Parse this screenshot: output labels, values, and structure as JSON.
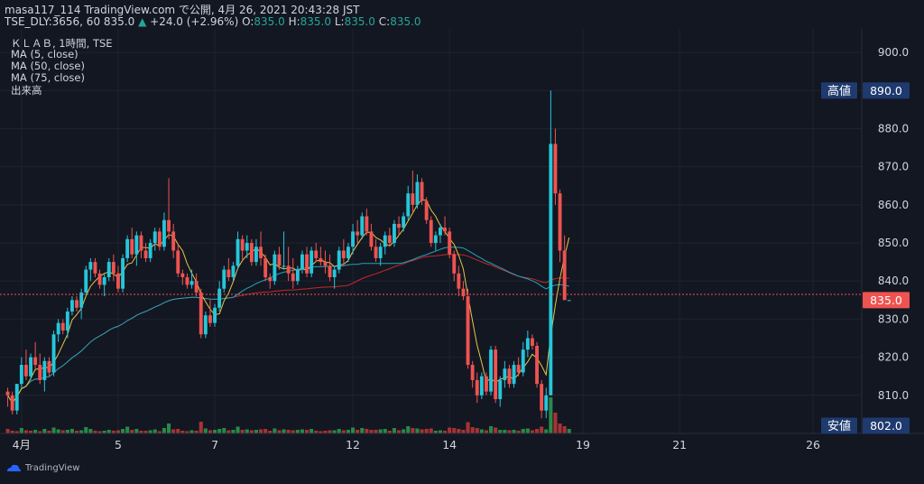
{
  "header": {
    "line1": "masa117_114 TradingView.com で公開, 4月 26, 2021 20:43:28 JST",
    "symbol_prefix": "TSE_DLY:3656, 60 835.0",
    "change_arrow": "▲",
    "change": "+24.0 (+2.96%)",
    "o_label": "O:",
    "o_value": "835.0",
    "h_label": "H:",
    "h_value": "835.0",
    "l_label": "L:",
    "l_value": "835.0",
    "c_label": "C:",
    "c_value": "835.0"
  },
  "legend": {
    "title": "ＫＬＡＢ, 1時間, TSE",
    "ma5": "MA (5, close)",
    "ma50": "MA (50, close)",
    "ma75": "MA (75, close)",
    "volume": "出来高"
  },
  "badges": {
    "high_label": "高値",
    "high_value": "890.0",
    "low_label": "安値",
    "low_value": "802.0",
    "last_value": "835.0"
  },
  "branding": {
    "logo_text": "TradingView"
  },
  "colors": {
    "background": "#131722",
    "up": "#26c6da",
    "down": "#ef5350",
    "ma5": "#e8c547",
    "ma50": "#21a4b8",
    "ma75": "#c62828",
    "vol_down": "#c2383a",
    "vol_up": "#2e9e4f",
    "badge_bg": "#1e3a6e",
    "last_bg": "#ef5350"
  },
  "chart_data": {
    "type": "candlestick",
    "ylim": [
      800,
      905
    ],
    "y_ticks": [
      "810.0",
      "820.0",
      "830.0",
      "840.0",
      "850.0",
      "860.0",
      "870.0",
      "880.0",
      "890.0",
      "900.0"
    ],
    "y_tick_values": [
      810,
      820,
      830,
      840,
      850,
      860,
      870,
      880,
      890,
      900
    ],
    "x_ticks": [
      {
        "label": "4月",
        "bar": 3
      },
      {
        "label": "5",
        "bar": 24
      },
      {
        "label": "7",
        "bar": 45
      },
      {
        "label": "12",
        "bar": 75
      },
      {
        "label": "14",
        "bar": 96
      },
      {
        "label": "19",
        "bar": 125
      },
      {
        "label": "21",
        "bar": 146
      },
      {
        "label": "26",
        "bar": 175
      }
    ],
    "candles": [
      [
        811,
        812,
        807,
        810
      ],
      [
        810,
        811,
        805,
        806
      ],
      [
        806,
        813,
        805,
        813
      ],
      [
        813,
        820,
        812,
        818
      ],
      [
        818,
        822,
        814,
        815
      ],
      [
        815,
        821,
        814,
        820
      ],
      [
        820,
        824,
        817,
        818
      ],
      [
        818,
        821,
        813,
        814
      ],
      [
        814,
        820,
        811,
        819
      ],
      [
        819,
        820,
        815,
        816
      ],
      [
        816,
        827,
        815,
        826
      ],
      [
        826,
        830,
        824,
        829
      ],
      [
        829,
        830,
        826,
        827
      ],
      [
        827,
        833,
        825,
        832
      ],
      [
        832,
        836,
        831,
        835
      ],
      [
        835,
        836,
        832,
        833
      ],
      [
        833,
        838,
        830,
        837
      ],
      [
        837,
        844,
        836,
        843
      ],
      [
        843,
        846,
        840,
        845
      ],
      [
        845,
        846,
        841,
        842
      ],
      [
        842,
        843,
        838,
        839
      ],
      [
        839,
        842,
        836,
        841
      ],
      [
        841,
        846,
        840,
        845
      ],
      [
        845,
        847,
        840,
        842
      ],
      [
        842,
        844,
        837,
        838
      ],
      [
        838,
        847,
        837,
        846
      ],
      [
        846,
        852,
        845,
        851
      ],
      [
        851,
        854,
        846,
        847
      ],
      [
        847,
        853,
        844,
        852
      ],
      [
        852,
        853,
        846,
        848
      ],
      [
        848,
        850,
        845,
        846
      ],
      [
        846,
        851,
        845,
        850
      ],
      [
        850,
        854,
        848,
        853
      ],
      [
        853,
        854,
        848,
        849
      ],
      [
        849,
        858,
        848,
        856
      ],
      [
        856,
        867,
        851,
        853
      ],
      [
        853,
        855,
        846,
        848
      ],
      [
        848,
        850,
        841,
        842
      ],
      [
        842,
        843,
        839,
        841
      ],
      [
        841,
        842,
        838,
        839
      ],
      [
        839,
        843,
        838,
        840
      ],
      [
        840,
        842,
        836,
        837
      ],
      [
        837,
        838,
        825,
        826
      ],
      [
        826,
        832,
        825,
        831
      ],
      [
        831,
        835,
        828,
        829
      ],
      [
        829,
        834,
        828,
        833
      ],
      [
        833,
        840,
        832,
        838
      ],
      [
        838,
        844,
        837,
        843
      ],
      [
        843,
        846,
        840,
        841
      ],
      [
        841,
        845,
        840,
        844
      ],
      [
        844,
        853,
        843,
        851
      ],
      [
        851,
        852,
        845,
        848
      ],
      [
        848,
        852,
        846,
        850
      ],
      [
        850,
        851,
        844,
        845
      ],
      [
        845,
        851,
        844,
        849
      ],
      [
        849,
        853,
        844,
        846
      ],
      [
        846,
        847,
        840,
        841
      ],
      [
        841,
        842,
        838,
        840
      ],
      [
        840,
        848,
        839,
        847
      ],
      [
        847,
        849,
        843,
        844
      ],
      [
        844,
        853,
        843,
        844
      ],
      [
        844,
        849,
        840,
        842
      ],
      [
        842,
        846,
        838,
        840
      ],
      [
        840,
        844,
        839,
        843
      ],
      [
        843,
        848,
        842,
        847
      ],
      [
        847,
        849,
        841,
        842
      ],
      [
        842,
        849,
        841,
        848
      ],
      [
        848,
        850,
        845,
        846
      ],
      [
        846,
        849,
        844,
        845
      ],
      [
        845,
        848,
        842,
        844
      ],
      [
        844,
        847,
        840,
        841
      ],
      [
        841,
        844,
        838,
        843
      ],
      [
        843,
        849,
        842,
        848
      ],
      [
        848,
        851,
        844,
        846
      ],
      [
        846,
        850,
        845,
        849
      ],
      [
        849,
        855,
        847,
        853
      ],
      [
        853,
        856,
        850,
        852
      ],
      [
        852,
        858,
        851,
        857
      ],
      [
        857,
        859,
        852,
        853
      ],
      [
        853,
        855,
        848,
        849
      ],
      [
        849,
        851,
        845,
        846
      ],
      [
        846,
        850,
        844,
        849
      ],
      [
        849,
        853,
        847,
        852
      ],
      [
        852,
        854,
        849,
        850
      ],
      [
        850,
        856,
        849,
        855
      ],
      [
        855,
        857,
        852,
        854
      ],
      [
        854,
        858,
        853,
        857
      ],
      [
        857,
        865,
        856,
        863
      ],
      [
        863,
        869,
        858,
        860
      ],
      [
        860,
        868,
        859,
        866
      ],
      [
        866,
        867,
        860,
        861
      ],
      [
        861,
        862,
        855,
        856
      ],
      [
        856,
        857,
        849,
        850
      ],
      [
        850,
        853,
        848,
        852
      ],
      [
        852,
        855,
        850,
        854
      ],
      [
        854,
        857,
        852,
        853
      ],
      [
        853,
        854,
        846,
        847
      ],
      [
        847,
        848,
        840,
        842
      ],
      [
        842,
        844,
        836,
        838
      ],
      [
        838,
        840,
        835,
        836
      ],
      [
        836,
        838,
        817,
        818
      ],
      [
        818,
        819,
        812,
        814
      ],
      [
        814,
        816,
        808,
        810
      ],
      [
        810,
        816,
        809,
        815
      ],
      [
        815,
        816,
        810,
        811
      ],
      [
        811,
        823,
        810,
        822
      ],
      [
        822,
        823,
        808,
        809
      ],
      [
        809,
        815,
        807,
        814
      ],
      [
        814,
        819,
        812,
        817
      ],
      [
        817,
        818,
        812,
        813
      ],
      [
        813,
        819,
        812,
        818
      ],
      [
        818,
        820,
        815,
        816
      ],
      [
        816,
        824,
        815,
        822
      ],
      [
        822,
        827,
        820,
        825
      ],
      [
        825,
        826,
        822,
        823
      ],
      [
        823,
        824,
        812,
        813
      ],
      [
        813,
        814,
        804,
        806
      ],
      [
        806,
        812,
        804,
        810
      ],
      [
        810,
        890,
        810,
        876
      ],
      [
        876,
        880,
        860,
        863
      ],
      [
        863,
        864,
        845,
        848
      ],
      [
        848,
        852,
        836,
        835
      ],
      [
        835,
        835,
        835,
        835
      ]
    ],
    "volume": [
      [
        1,
        0
      ],
      [
        0.6,
        0
      ],
      [
        0.5,
        0
      ],
      [
        1.2,
        1
      ],
      [
        0.7,
        0
      ],
      [
        0.6,
        0
      ],
      [
        0.8,
        1
      ],
      [
        0.5,
        0
      ],
      [
        1,
        1
      ],
      [
        0.6,
        0
      ],
      [
        1.3,
        1
      ],
      [
        0.9,
        1
      ],
      [
        0.7,
        0
      ],
      [
        0.8,
        1
      ],
      [
        1,
        1
      ],
      [
        0.6,
        0
      ],
      [
        0.7,
        1
      ],
      [
        1.4,
        1
      ],
      [
        1,
        1
      ],
      [
        0.6,
        0
      ],
      [
        0.5,
        0
      ],
      [
        0.6,
        1
      ],
      [
        0.8,
        1
      ],
      [
        0.6,
        0
      ],
      [
        0.7,
        0
      ],
      [
        1,
        1
      ],
      [
        1.5,
        1
      ],
      [
        0.8,
        0
      ],
      [
        1,
        1
      ],
      [
        0.6,
        0
      ],
      [
        0.6,
        0
      ],
      [
        0.7,
        1
      ],
      [
        0.9,
        1
      ],
      [
        0.5,
        0
      ],
      [
        1.2,
        1
      ],
      [
        2.2,
        1
      ],
      [
        0.9,
        0
      ],
      [
        1,
        0
      ],
      [
        0.6,
        0
      ],
      [
        0.5,
        0
      ],
      [
        0.7,
        1
      ],
      [
        0.6,
        0
      ],
      [
        2.6,
        0
      ],
      [
        1.1,
        1
      ],
      [
        0.7,
        0
      ],
      [
        0.8,
        1
      ],
      [
        1,
        1
      ],
      [
        1.2,
        1
      ],
      [
        0.7,
        0
      ],
      [
        0.8,
        1
      ],
      [
        1.5,
        1
      ],
      [
        0.8,
        0
      ],
      [
        0.9,
        1
      ],
      [
        0.7,
        0
      ],
      [
        0.8,
        1
      ],
      [
        0.9,
        0
      ],
      [
        1,
        0
      ],
      [
        0.6,
        0
      ],
      [
        1.1,
        1
      ],
      [
        0.7,
        0
      ],
      [
        0.9,
        1
      ],
      [
        0.8,
        0
      ],
      [
        0.7,
        0
      ],
      [
        0.8,
        1
      ],
      [
        0.9,
        1
      ],
      [
        0.8,
        0
      ],
      [
        1,
        1
      ],
      [
        0.6,
        0
      ],
      [
        0.5,
        0
      ],
      [
        0.6,
        0
      ],
      [
        0.7,
        0
      ],
      [
        0.7,
        1
      ],
      [
        1,
        1
      ],
      [
        0.7,
        0
      ],
      [
        0.8,
        1
      ],
      [
        1.3,
        1
      ],
      [
        0.8,
        0
      ],
      [
        1.2,
        1
      ],
      [
        1,
        0
      ],
      [
        0.8,
        0
      ],
      [
        0.8,
        0
      ],
      [
        0.9,
        1
      ],
      [
        1,
        1
      ],
      [
        0.6,
        0
      ],
      [
        1.2,
        1
      ],
      [
        0.7,
        0
      ],
      [
        0.9,
        1
      ],
      [
        1.6,
        1
      ],
      [
        1.2,
        0
      ],
      [
        1.1,
        1
      ],
      [
        0.9,
        0
      ],
      [
        1,
        0
      ],
      [
        1.1,
        0
      ],
      [
        0.6,
        1
      ],
      [
        0.7,
        1
      ],
      [
        0.6,
        0
      ],
      [
        1.3,
        0
      ],
      [
        1.2,
        0
      ],
      [
        1,
        0
      ],
      [
        0.8,
        0
      ],
      [
        2.5,
        0
      ],
      [
        1.4,
        0
      ],
      [
        1.2,
        0
      ],
      [
        0.9,
        1
      ],
      [
        0.7,
        0
      ],
      [
        1.6,
        1
      ],
      [
        1.3,
        0
      ],
      [
        0.8,
        1
      ],
      [
        0.8,
        1
      ],
      [
        0.7,
        0
      ],
      [
        0.8,
        1
      ],
      [
        0.6,
        0
      ],
      [
        1,
        1
      ],
      [
        1.1,
        1
      ],
      [
        0.7,
        0
      ],
      [
        1,
        0
      ],
      [
        1.5,
        0
      ],
      [
        0.9,
        1
      ],
      [
        8,
        1
      ],
      [
        4.6,
        0
      ],
      [
        2.2,
        0
      ],
      [
        1.6,
        0
      ],
      [
        1,
        1
      ]
    ]
  }
}
